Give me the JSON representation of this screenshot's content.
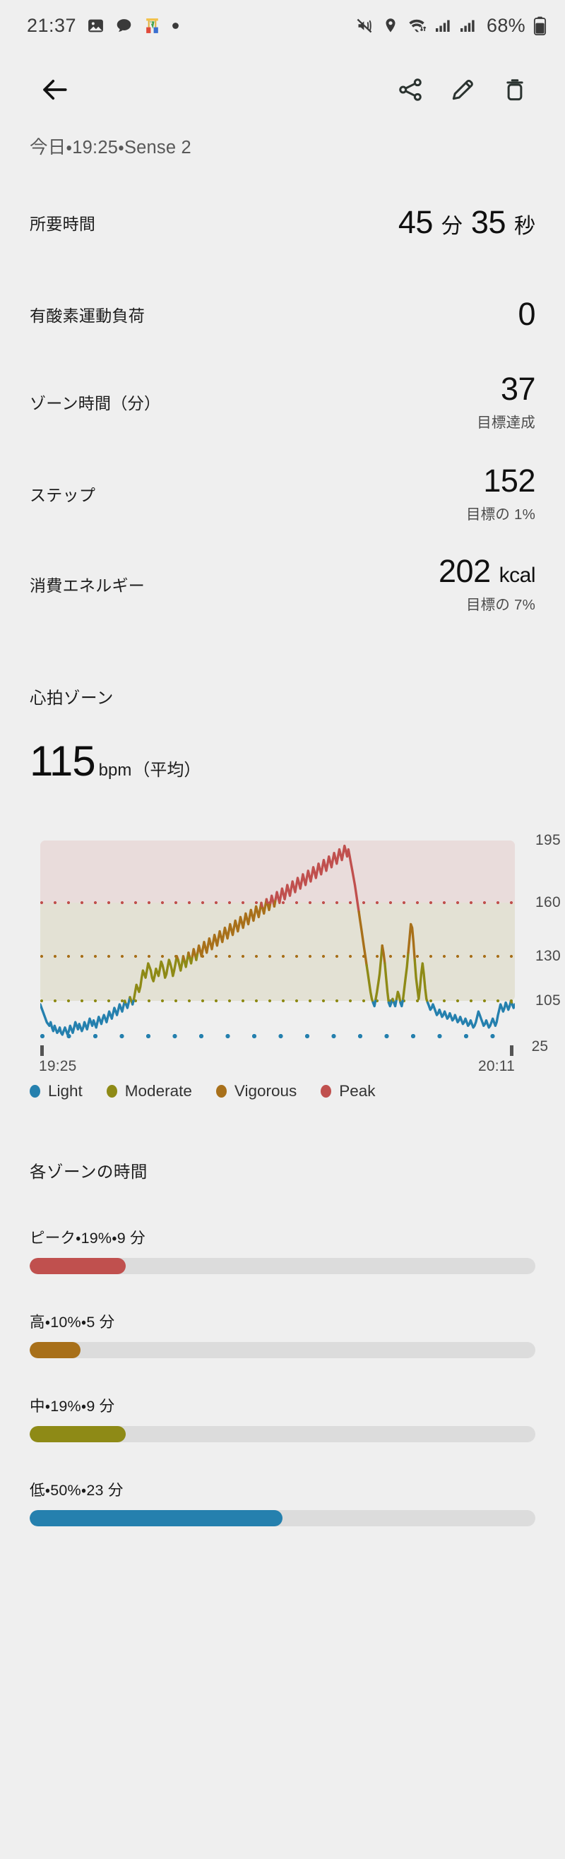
{
  "statusbar": {
    "time": "21:37",
    "battery_percent": "68%",
    "left_icons": [
      "image-icon",
      "chat-bubble-icon",
      "app-icon",
      "dot-icon"
    ],
    "right_icons": [
      "ringer-vibrate-off-icon",
      "location-icon",
      "wifi-icon",
      "signal-bars-icon",
      "signal-bars-icon",
      "battery-icon"
    ]
  },
  "toolbar": {
    "back": "back-arrow-icon",
    "share": "share-icon",
    "edit": "pencil-icon",
    "delete": "trash-icon"
  },
  "header": {
    "subtitle": "今日・19:25・Sense 2"
  },
  "stats": [
    {
      "label": "所要時間",
      "value": "45",
      "unit": "分",
      "value2": "35",
      "unit2": "秒",
      "sub": ""
    },
    {
      "label": "有酸素運動負荷",
      "value": "0",
      "unit": "",
      "sub": ""
    },
    {
      "label": "ゾーン時間（分）",
      "value": "37",
      "unit": "",
      "sub": "目標達成"
    },
    {
      "label": "ステップ",
      "value": "152",
      "unit": "",
      "sub": "目標の 1%"
    },
    {
      "label": "消費エネルギー",
      "value": "202",
      "unit": "kcal",
      "sub": "目標の 7%"
    }
  ],
  "hr_section": {
    "title": "心拍ゾーン",
    "avg_value": "115",
    "avg_unit": "bpm",
    "avg_note": "（平均）"
  },
  "legend": [
    {
      "label": "Light",
      "color": "#2580AE"
    },
    {
      "label": "Moderate",
      "color": "#8E8A16"
    },
    {
      "label": "Vigorous",
      "color": "#A8701A"
    },
    {
      "label": "Peak",
      "color": "#C0504E"
    }
  ],
  "zone_time": {
    "title": "各ゾーンの時間",
    "rows": [
      {
        "label": "ピーク・19%・9 分",
        "percent": 19,
        "color": "#C0504E"
      },
      {
        "label": "高・10%・5 分",
        "percent": 10,
        "color": "#A8701A"
      },
      {
        "label": "中・19%・9 分",
        "percent": 19,
        "color": "#8E8A16"
      },
      {
        "label": "低・50%・23 分",
        "percent": 50,
        "color": "#2580AE"
      }
    ]
  },
  "chart_data": {
    "type": "line",
    "title": "心拍ゾーン",
    "xlabel": "",
    "ylabel": "bpm",
    "x_start_label": "19:25",
    "x_end_label": "20:11",
    "x_right_number": "25",
    "ytick_labels": [
      "195",
      "160",
      "130",
      "105"
    ],
    "ytick_values": [
      195,
      160,
      130,
      105
    ],
    "ylim": [
      80,
      200
    ],
    "grid": true,
    "legend_position": "bottom",
    "zones": [
      {
        "name": "Peak",
        "min": 160,
        "max": 195,
        "band_color": "#E9DCDB",
        "line_color": "#C0504E"
      },
      {
        "name": "Vigorous",
        "min": 130,
        "max": 160,
        "band_color": "#E3E1D4",
        "line_color": "#A8701A"
      },
      {
        "name": "Moderate",
        "min": 105,
        "max": 130,
        "band_color": "#E3E1D4",
        "line_color": "#8E8A16"
      },
      {
        "name": "Light",
        "min": 80,
        "max": 105,
        "band_color": "none",
        "line_color": "#2580AE"
      }
    ],
    "series": [
      {
        "name": "Heart rate",
        "values": [
          103,
          101,
          99,
          97,
          95,
          93,
          92,
          91,
          93,
          90,
          88,
          91,
          89,
          87,
          88,
          90,
          87,
          86,
          88,
          90,
          88,
          86,
          88,
          91,
          89,
          87,
          90,
          93,
          91,
          89,
          92,
          90,
          88,
          90,
          93,
          91,
          89,
          92,
          95,
          93,
          91,
          94,
          92,
          90,
          93,
          96,
          94,
          92,
          95,
          97,
          95,
          93,
          96,
          99,
          97,
          95,
          98,
          101,
          99,
          97,
          100,
          103,
          101,
          99,
          102,
          105,
          103,
          101,
          104,
          107,
          105,
          103,
          106,
          110,
          114,
          112,
          110,
          113,
          118,
          122,
          120,
          118,
          122,
          126,
          124,
          122,
          118,
          116,
          119,
          123,
          121,
          119,
          123,
          127,
          125,
          122,
          118,
          120,
          124,
          128,
          126,
          123,
          119,
          122,
          126,
          130,
          128,
          125,
          122,
          126,
          130,
          127,
          124,
          128,
          132,
          129,
          126,
          130,
          134,
          131,
          128,
          132,
          136,
          133,
          130,
          134,
          138,
          135,
          132,
          136,
          140,
          137,
          134,
          138,
          142,
          139,
          136,
          140,
          144,
          141,
          138,
          142,
          146,
          143,
          140,
          144,
          148,
          145,
          142,
          146,
          150,
          147,
          144,
          148,
          152,
          149,
          146,
          150,
          154,
          151,
          148,
          152,
          156,
          153,
          150,
          154,
          158,
          155,
          152,
          156,
          160,
          157,
          154,
          158,
          162,
          159,
          156,
          160,
          164,
          161,
          158,
          162,
          166,
          163,
          160,
          164,
          168,
          165,
          162,
          166,
          170,
          167,
          164,
          168,
          172,
          169,
          166,
          170,
          174,
          171,
          168,
          172,
          176,
          173,
          170,
          174,
          178,
          175,
          172,
          176,
          180,
          177,
          174,
          178,
          182,
          179,
          176,
          180,
          184,
          181,
          178,
          182,
          186,
          183,
          180,
          184,
          188,
          185,
          182,
          186,
          190,
          187,
          184,
          188,
          192,
          189,
          186,
          190,
          186,
          182,
          178,
          174,
          170,
          165,
          160,
          155,
          150,
          145,
          140,
          135,
          130,
          125,
          120,
          115,
          110,
          106,
          104,
          102,
          106,
          110,
          115,
          120,
          128,
          136,
          132,
          126,
          118,
          110,
          104,
          102,
          104,
          106,
          104,
          102,
          106,
          110,
          108,
          104,
          102,
          106,
          112,
          118,
          124,
          132,
          140,
          148,
          146,
          138,
          128,
          118,
          112,
          106,
          112,
          120,
          126,
          120,
          112,
          106,
          104,
          102,
          100,
          101,
          103,
          101,
          99,
          97,
          98,
          100,
          98,
          96,
          97,
          99,
          97,
          95,
          96,
          98,
          96,
          94,
          95,
          97,
          95,
          93,
          94,
          96,
          94,
          92,
          93,
          95,
          93,
          91,
          92,
          94,
          92,
          90,
          91,
          93,
          96,
          99,
          97,
          95,
          93,
          91,
          92,
          94,
          92,
          90,
          91,
          93,
          95,
          93,
          91,
          93,
          97,
          100,
          103,
          101,
          99,
          101,
          104,
          102,
          100,
          102,
          105,
          103,
          101,
          103
        ]
      }
    ]
  }
}
